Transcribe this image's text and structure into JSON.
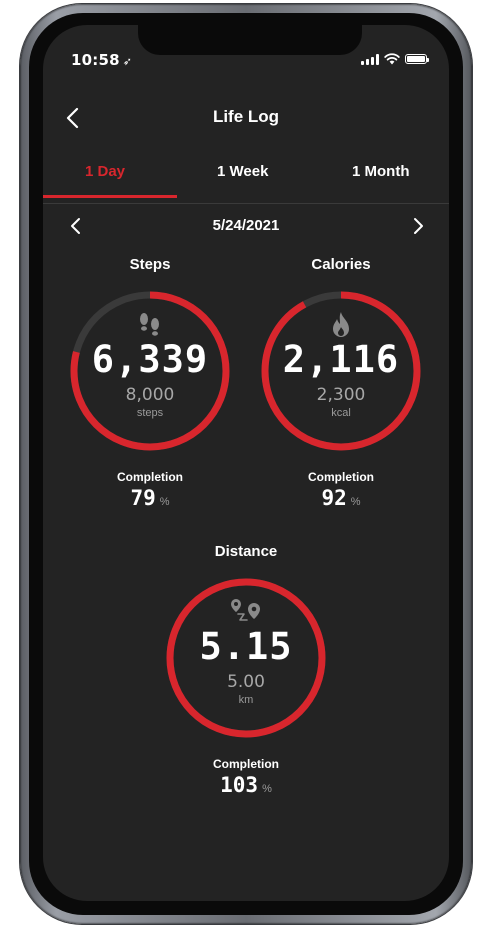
{
  "status_bar": {
    "time": "10:58",
    "location_glyph": "➶"
  },
  "header": {
    "title": "Life Log"
  },
  "tabs": [
    {
      "label": "1 Day",
      "active": true
    },
    {
      "label": "1 Week",
      "active": false
    },
    {
      "label": "1 Month",
      "active": false
    }
  ],
  "date_nav": {
    "date": "5/24/2021"
  },
  "metrics": {
    "steps": {
      "title": "Steps",
      "value": "6,339",
      "goal": "8,000",
      "unit": "steps",
      "completion_label": "Completion",
      "completion": "79",
      "completion_unit": "%",
      "ring_fraction": 0.79,
      "icon": "footprints-icon"
    },
    "calories": {
      "title": "Calories",
      "value": "2,116",
      "goal": "2,300",
      "unit": "kcal",
      "completion_label": "Completion",
      "completion": "92",
      "completion_unit": "%",
      "ring_fraction": 0.92,
      "icon": "flame-icon"
    },
    "distance": {
      "title": "Distance",
      "value": "5.15",
      "goal": "5.00",
      "unit": "km",
      "completion_label": "Completion",
      "completion": "103",
      "completion_unit": "%",
      "ring_fraction": 1.0,
      "icon": "route-icon"
    }
  },
  "colors": {
    "accent": "#d8262d",
    "background": "#232323",
    "ring_track": "#3a3a3a"
  }
}
